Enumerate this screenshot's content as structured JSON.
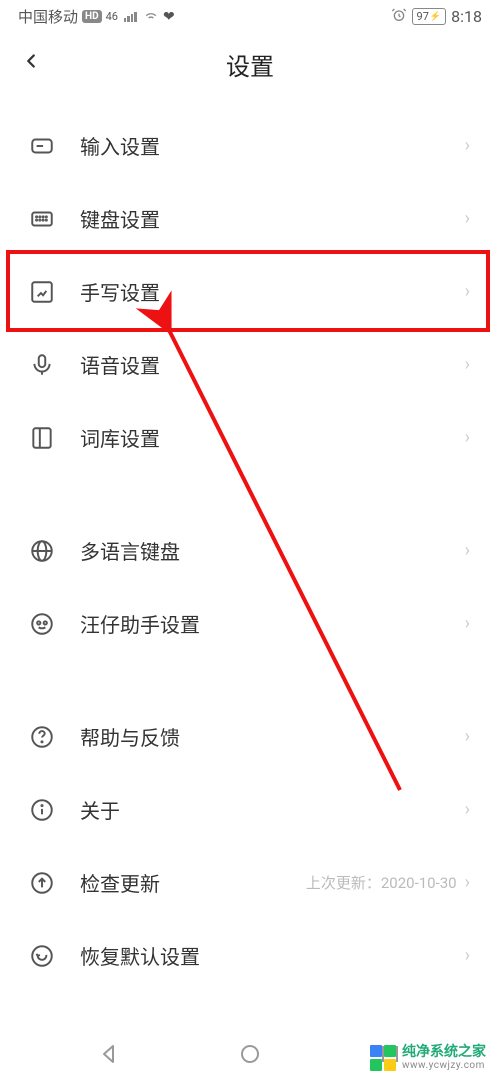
{
  "status": {
    "carrier": "中国移动",
    "hd": "HD",
    "net": "4G",
    "net2": "46",
    "time": "8:18",
    "battery": "97"
  },
  "header": {
    "title": "设置"
  },
  "sections": [
    {
      "items": [
        {
          "icon": "input",
          "label": "输入设置"
        },
        {
          "icon": "keyboard",
          "label": "键盘设置"
        },
        {
          "icon": "handwrite",
          "label": "手写设置"
        },
        {
          "icon": "mic",
          "label": "语音设置"
        },
        {
          "icon": "dict",
          "label": "词库设置"
        }
      ]
    },
    {
      "items": [
        {
          "icon": "globe",
          "label": "多语言键盘"
        },
        {
          "icon": "assistant",
          "label": "汪仔助手设置"
        }
      ]
    },
    {
      "items": [
        {
          "icon": "help",
          "label": "帮助与反馈"
        },
        {
          "icon": "info",
          "label": "关于"
        },
        {
          "icon": "update",
          "label": "检查更新",
          "sub": "上次更新：2020-10-30"
        },
        {
          "icon": "reset",
          "label": "恢复默认设置"
        }
      ]
    }
  ],
  "watermark": {
    "title": "纯净系统之家",
    "url": "www.ycwjzy.com"
  }
}
